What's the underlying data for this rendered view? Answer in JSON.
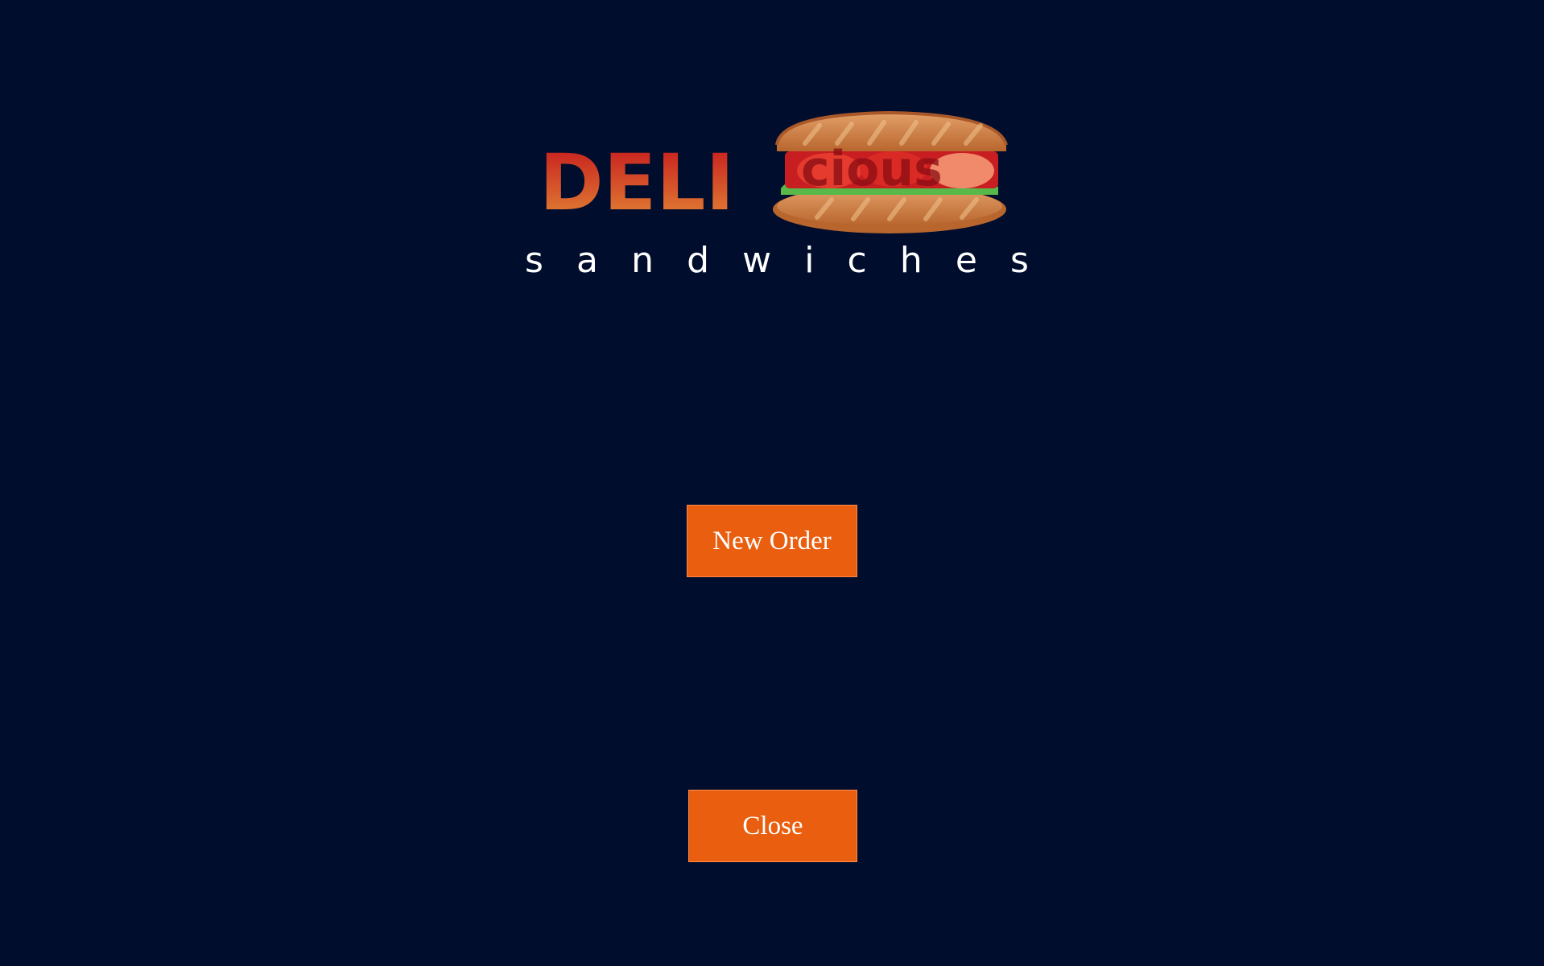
{
  "app": {
    "background_color": "#000d2d",
    "accent_color": "#e95e0f"
  },
  "logo": {
    "word": "DELI",
    "word_suffix": "cious",
    "tagline": "sandwiches",
    "icon": "sandwich-icon"
  },
  "buttons": {
    "new_order_label": "New Order",
    "close_label": "Close"
  }
}
